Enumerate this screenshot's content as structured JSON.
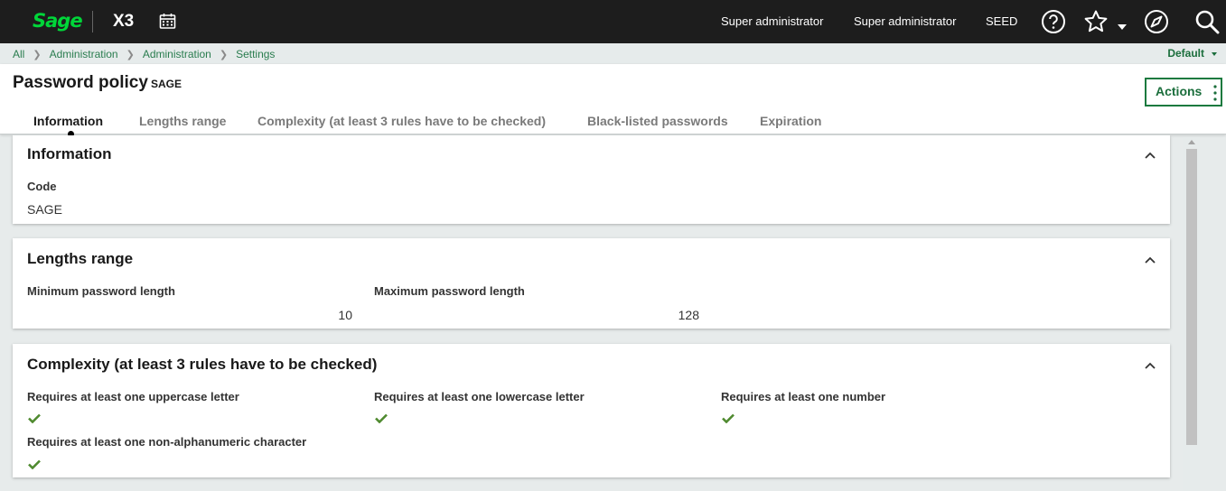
{
  "topbar": {
    "logo": "Sage",
    "app_name": "X3",
    "user1": "Super administrator",
    "user2": "Super administrator",
    "folder": "SEED"
  },
  "breadcrumb": {
    "items": [
      "All",
      "Administration",
      "Administration",
      "Settings"
    ],
    "default_selector": "Default"
  },
  "header": {
    "title": "Password policy",
    "subtitle": "SAGE",
    "actions_label": "Actions",
    "tabs": [
      {
        "label": "Information",
        "active": true
      },
      {
        "label": "Lengths range",
        "active": false
      },
      {
        "label": "Complexity (at least 3 rules have to be checked)",
        "active": false
      },
      {
        "label": "Black-listed passwords",
        "active": false
      },
      {
        "label": "Expiration",
        "active": false
      }
    ]
  },
  "sections": {
    "information": {
      "title": "Information",
      "code_label": "Code",
      "code_value": "SAGE"
    },
    "lengths": {
      "title": "Lengths range",
      "min_label": "Minimum password length",
      "min_value": "10",
      "max_label": "Maximum password length",
      "max_value": "128"
    },
    "complexity": {
      "title": "Complexity (at least 3 rules have to be checked)",
      "rules": [
        {
          "label": "Requires at least one uppercase letter",
          "checked": true
        },
        {
          "label": "Requires at least one lowercase letter",
          "checked": true
        },
        {
          "label": "Requires at least one number",
          "checked": true
        },
        {
          "label": "Requires at least one non-alphanumeric character",
          "checked": true
        }
      ]
    }
  },
  "colors": {
    "topbar_bg": "#1d1d1d",
    "brand_green": "#00d639",
    "link_green": "#2a7d4f",
    "check_green": "#4f8a2f"
  }
}
